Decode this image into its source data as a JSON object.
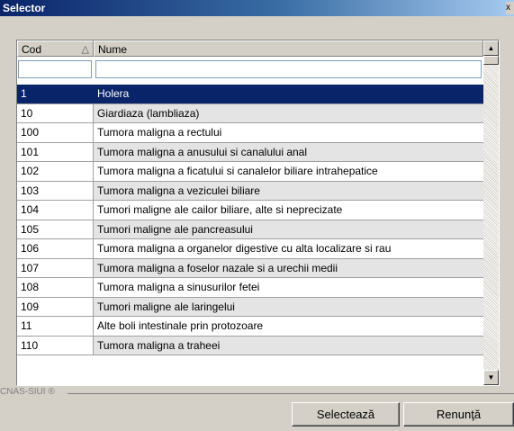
{
  "window": {
    "title": "Selector",
    "close_label": "x"
  },
  "grid": {
    "columns": [
      {
        "label": "Cod",
        "sort_icon": "sort-ascending-icon",
        "sort_glyph": "△"
      },
      {
        "label": "Nume"
      }
    ],
    "filters": {
      "code_value": "",
      "name_value": ""
    },
    "rows": [
      {
        "code": "1",
        "name": "Holera",
        "selected": true
      },
      {
        "code": "10",
        "name": "Giardiaza (lambliaza)"
      },
      {
        "code": "100",
        "name": "Tumora maligna a rectului"
      },
      {
        "code": "101",
        "name": "Tumora maligna a anusului si canalului anal"
      },
      {
        "code": "102",
        "name": "Tumora maligna a ficatului si canalelor biliare intrahepatice"
      },
      {
        "code": "103",
        "name": "Tumora maligna a veziculei biliare"
      },
      {
        "code": "104",
        "name": "Tumori maligne ale cailor biliare, alte si neprecizate"
      },
      {
        "code": "105",
        "name": "Tumori maligne ale pancreasului"
      },
      {
        "code": "106",
        "name": "Tumora maligna a organelor digestive cu alta localizare si rau"
      },
      {
        "code": "107",
        "name": "Tumora maligna a foselor nazale si a urechii medii"
      },
      {
        "code": "108",
        "name": "Tumora maligna a sinusurilor fetei"
      },
      {
        "code": "109",
        "name": "Tumori maligne ale laringelui"
      },
      {
        "code": "11",
        "name": "Alte boli intestinale prin protozoare"
      },
      {
        "code": "110",
        "name": "Tumora maligna a traheei"
      }
    ]
  },
  "footer": {
    "brand": "CNAS-SIUI ®",
    "select_label": "Selectează",
    "cancel_label": "Renunţă"
  },
  "colors": {
    "selection": "#0a246a",
    "alt_row": "#e4e4e4"
  }
}
